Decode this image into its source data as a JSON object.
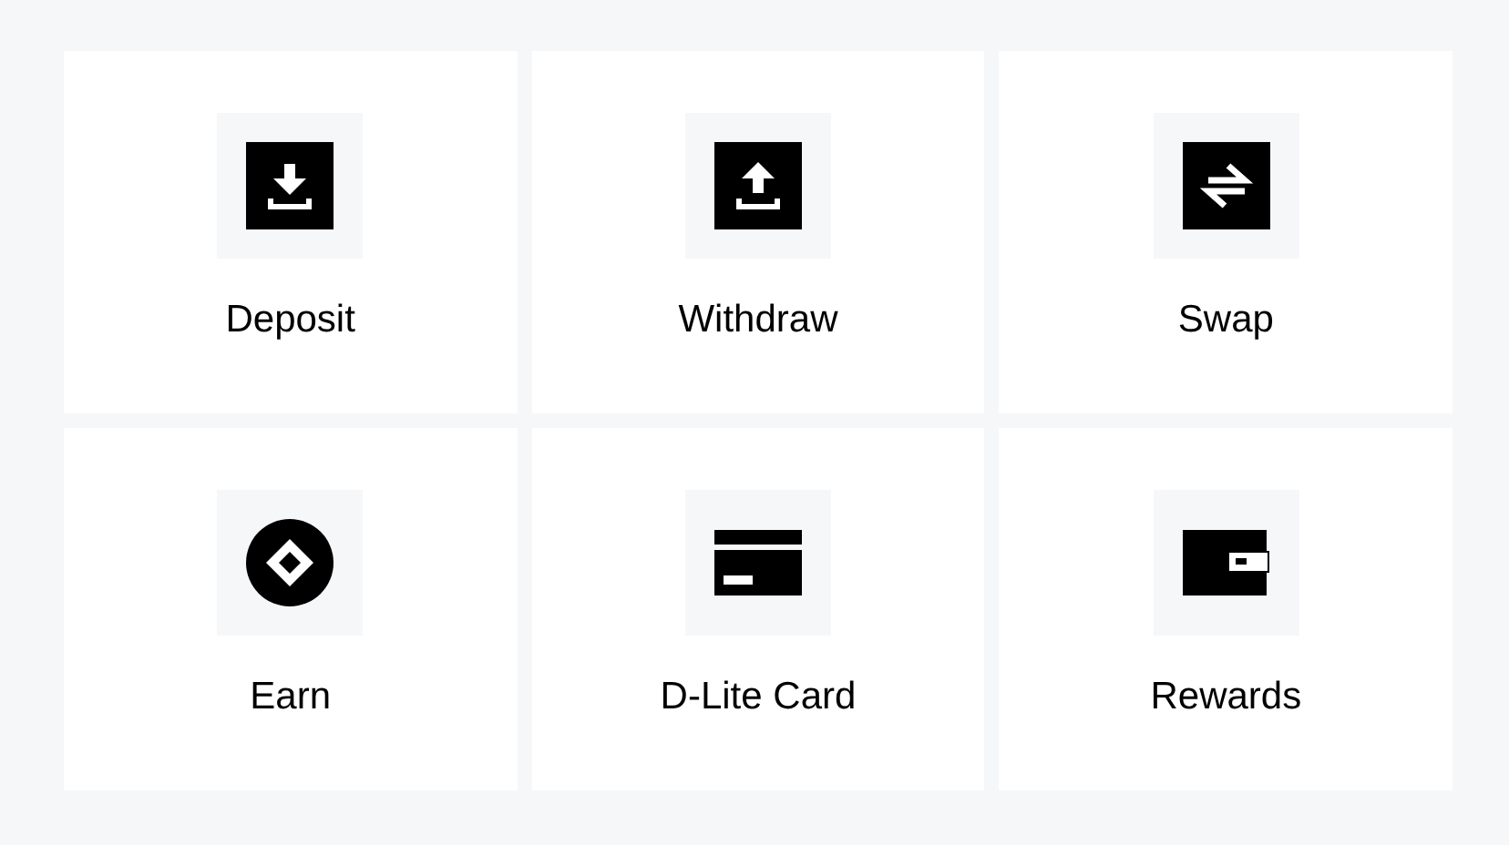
{
  "actions": [
    {
      "label": "Deposit",
      "kind": "deposit"
    },
    {
      "label": "Withdraw",
      "kind": "withdraw"
    },
    {
      "label": "Swap",
      "kind": "swap"
    },
    {
      "label": "Earn",
      "kind": "earn"
    },
    {
      "label": "D-Lite Card",
      "kind": "card"
    },
    {
      "label": "Rewards",
      "kind": "wallet"
    }
  ]
}
